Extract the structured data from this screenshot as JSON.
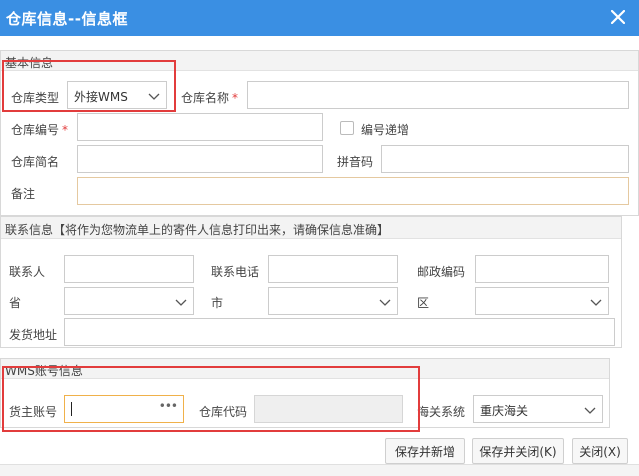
{
  "window": {
    "title": "仓库信息--信息框"
  },
  "basic": {
    "header": "基本信息",
    "warehouse_type_label": "仓库类型",
    "warehouse_type_value": "外接WMS",
    "warehouse_name_label": "仓库名称",
    "warehouse_code_label": "仓库编号",
    "auto_increment_label": "编号递增",
    "short_name_label": "仓库简名",
    "pinyin_label": "拼音码",
    "remark_label": "备注",
    "required_mark": "*"
  },
  "contact": {
    "header": "联系信息【将作为您物流单上的寄件人信息打印出来，请确保信息准确】",
    "contact_label": "联系人",
    "phone_label": "联系电话",
    "postcode_label": "邮政编码",
    "province_label": "省",
    "city_label": "市",
    "district_label": "区",
    "address_label": "发货地址"
  },
  "wms": {
    "header": "WMS账号信息",
    "owner_label": "货主账号",
    "owner_dots": "•••",
    "warehouse_code_label": "仓库代码",
    "customs_label": "海关系统",
    "customs_value": "重庆海关"
  },
  "buttons": {
    "save_new": "保存并新增",
    "save_close": "保存并关闭(K)",
    "close": "关闭(X)"
  },
  "colors": {
    "titlebar": "#3a8fe3",
    "highlight": "#e23c3c",
    "required": "#e23c3c"
  }
}
